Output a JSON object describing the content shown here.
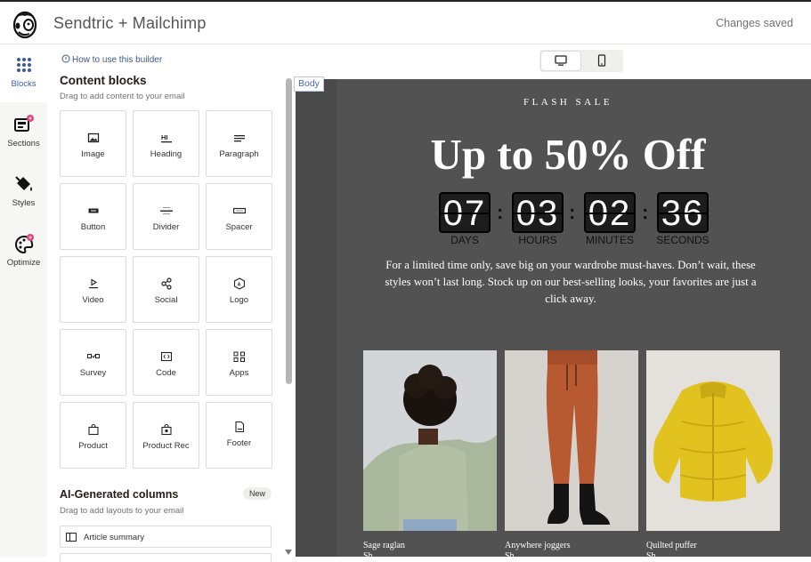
{
  "header": {
    "app_title": "Sendtric + Mailchimp",
    "status": "Changes saved"
  },
  "rail": {
    "items": [
      {
        "label": "Blocks",
        "icon": "dots-grid-icon",
        "active": true
      },
      {
        "label": "Sections",
        "icon": "sections-icon"
      },
      {
        "label": "Styles",
        "icon": "paint-bucket-icon"
      },
      {
        "label": "Optimize",
        "icon": "palette-icon"
      }
    ]
  },
  "panel": {
    "howto_label": "How to use this builder",
    "title": "Content blocks",
    "subtitle": "Drag to add content to your email",
    "blocks": [
      {
        "label": "Image",
        "icon": "image-icon"
      },
      {
        "label": "Heading",
        "icon": "heading-icon"
      },
      {
        "label": "Paragraph",
        "icon": "paragraph-icon"
      },
      {
        "label": "Button",
        "icon": "button-icon"
      },
      {
        "label": "Divider",
        "icon": "divider-icon"
      },
      {
        "label": "Spacer",
        "icon": "spacer-icon"
      },
      {
        "label": "Video",
        "icon": "video-icon"
      },
      {
        "label": "Social",
        "icon": "social-icon"
      },
      {
        "label": "Logo",
        "icon": "logo-icon"
      },
      {
        "label": "Survey",
        "icon": "survey-icon"
      },
      {
        "label": "Code",
        "icon": "code-icon"
      },
      {
        "label": "Apps",
        "icon": "apps-icon"
      },
      {
        "label": "Product",
        "icon": "product-icon"
      },
      {
        "label": "Product Rec",
        "icon": "product-rec-icon"
      },
      {
        "label": "Footer",
        "icon": "footer-icon"
      }
    ],
    "ai_title": "AI-Generated columns",
    "ai_badge": "New",
    "ai_subtitle": "Drag to add layouts to your email",
    "ai_items": [
      {
        "label": "Article summary",
        "icon": "article-icon"
      }
    ]
  },
  "preview": {
    "body_tag": "Body",
    "device_options": [
      "desktop-icon",
      "mobile-icon"
    ],
    "selected_device": "desktop",
    "email": {
      "eyebrow": "FLASH SALE",
      "headline": "Up to 50% Off",
      "countdown": [
        {
          "value": "07",
          "label": "DAYS"
        },
        {
          "value": "03",
          "label": "HOURS"
        },
        {
          "value": "02",
          "label": "MINUTES"
        },
        {
          "value": "36",
          "label": "SECONDS"
        }
      ],
      "promo_text": "For a limited time only, save big on your wardrobe must-haves. Don’t wait, these styles won’t last long. Stock up on our best-selling looks, your favorites are just a click away.",
      "products": [
        {
          "name": "Sage raglan",
          "sub": "Sh",
          "image": "sage-raglan-photo"
        },
        {
          "name": "Anywhere joggers",
          "sub": "Sh",
          "image": "anywhere-joggers-photo"
        },
        {
          "name": "Quilted puffer",
          "sub": "Sh",
          "image": "quilted-puffer-photo"
        }
      ]
    }
  },
  "colors": {
    "canvas_bg": "#525252",
    "accent": "#4469b0",
    "badge_pink": "#e3447c"
  }
}
